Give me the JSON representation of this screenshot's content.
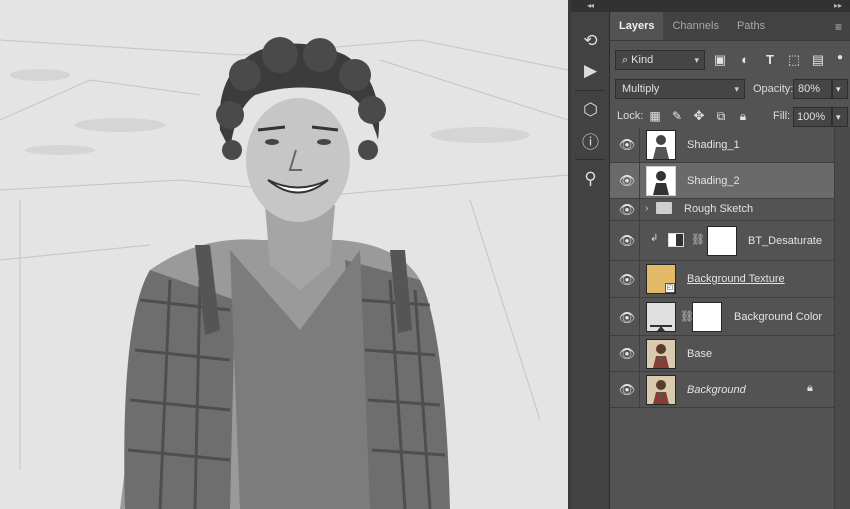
{
  "toolstrip": {
    "collapse_label": "◂◂",
    "tools": [
      {
        "icon": "history-brush-icon",
        "glyph": "⟲"
      },
      {
        "icon": "play-action-icon",
        "glyph": "▶"
      },
      {
        "icon": "3d-cube-icon",
        "glyph": "⬡"
      },
      {
        "icon": "info-icon",
        "glyph": "ⓘ"
      },
      {
        "icon": "clone-source-icon",
        "glyph": "⚲"
      }
    ]
  },
  "panel": {
    "collapse_label": "▸▸",
    "tabs": [
      {
        "label": "Layers",
        "active": true
      },
      {
        "label": "Channels",
        "active": false
      },
      {
        "label": "Paths",
        "active": false
      }
    ],
    "filter": {
      "kind_label": "Kind"
    },
    "blend_mode": "Multiply",
    "opacity_label": "Opacity:",
    "opacity_value": "80%",
    "lock_label": "Lock:",
    "fill_label": "Fill:",
    "fill_value": "100%",
    "layers": [
      {
        "name": "Shading_1",
        "kind": "pixel",
        "selected": false,
        "italic": false
      },
      {
        "name": "Shading_2",
        "kind": "pixel",
        "selected": true,
        "italic": false
      },
      {
        "name": "Rough Sketch",
        "kind": "group",
        "selected": false,
        "italic": false
      },
      {
        "name": "BT_Desaturate",
        "kind": "adjustment",
        "selected": false,
        "italic": false
      },
      {
        "name": "Background Texture",
        "kind": "smart",
        "selected": false,
        "italic": false
      },
      {
        "name": "Background Color",
        "kind": "fill",
        "selected": false,
        "italic": false
      },
      {
        "name": "Base",
        "kind": "photo",
        "selected": false,
        "italic": false
      },
      {
        "name": "Background",
        "kind": "photo-locked",
        "selected": false,
        "italic": true
      }
    ]
  },
  "colors": {
    "texture_swatch": "#e2b969",
    "panel_bg": "#535353",
    "selected_row": "#6a6a6a"
  }
}
